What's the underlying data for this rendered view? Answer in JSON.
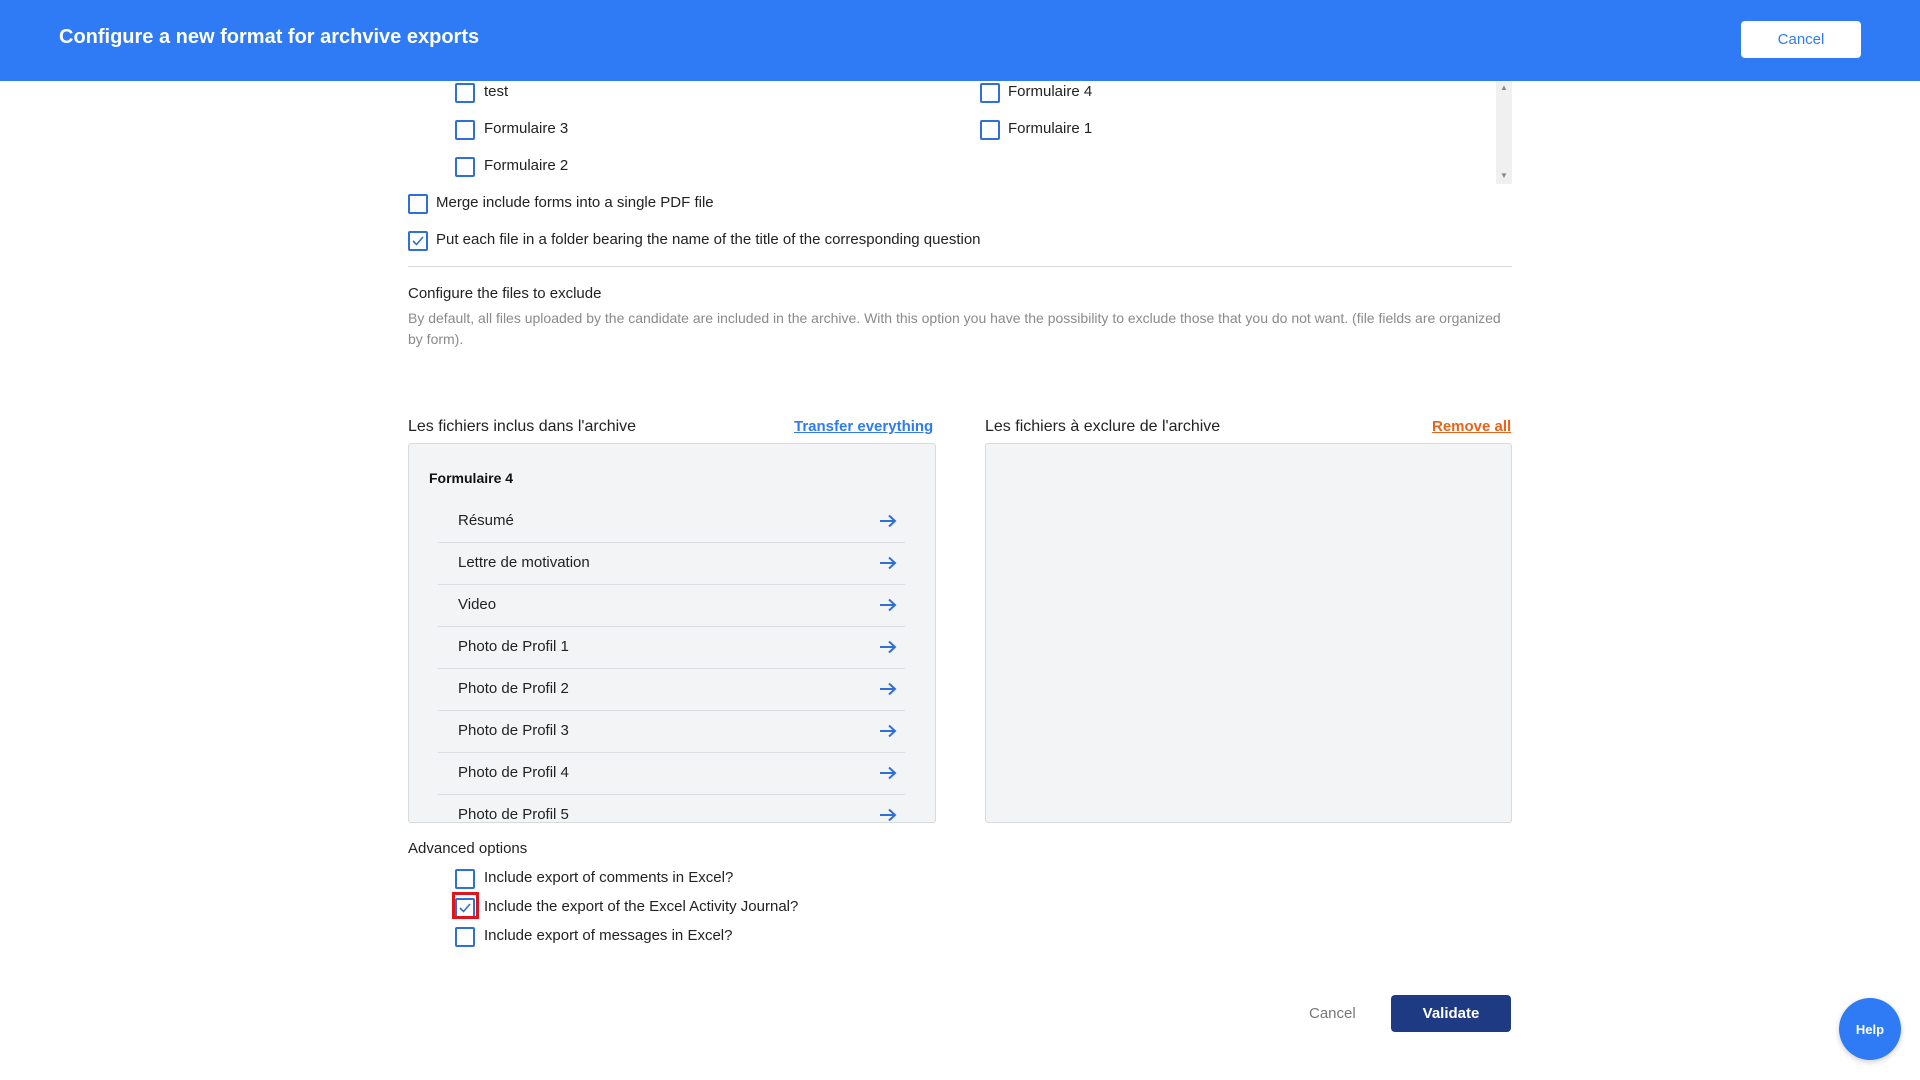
{
  "header": {
    "title": "Configure a new format for archvive exports",
    "cancel_label": "Cancel"
  },
  "forms": {
    "items": [
      {
        "label": "test",
        "checked": false
      },
      {
        "label": "Formulaire 3",
        "checked": false
      },
      {
        "label": "Formulaire 2",
        "checked": false
      },
      {
        "label": "Formulaire 4",
        "checked": false
      },
      {
        "label": "Formulaire 1",
        "checked": false
      }
    ]
  },
  "options": {
    "merge_label": "Merge include forms into a single PDF file",
    "merge_checked": false,
    "folder_label": "Put each file in a folder bearing the name of the title of the corresponding question",
    "folder_checked": true
  },
  "exclude": {
    "title": "Configure the files to exclude",
    "description": "By default, all files uploaded by the candidate are included in the archive. With this option you have the possibility to exclude those that you do not want. (file fields are organized by form)."
  },
  "included_panel": {
    "title": "Les fichiers inclus dans l'archive",
    "transfer_label": "Transfer everything",
    "group_title": "Formulaire 4",
    "files": [
      "Résumé",
      "Lettre de motivation",
      "Video",
      "Photo de Profil 1",
      "Photo de Profil 2",
      "Photo de Profil 3",
      "Photo de Profil 4",
      "Photo de Profil 5"
    ]
  },
  "excluded_panel": {
    "title": "Les fichiers à exclure de l'archive",
    "remove_label": "Remove all"
  },
  "advanced": {
    "title": "Advanced options",
    "items": [
      {
        "label": "Include export of comments in Excel?",
        "checked": false
      },
      {
        "label": "Include the export of the Excel Activity Journal?",
        "checked": true
      },
      {
        "label": "Include export of messages in Excel?",
        "checked": false
      }
    ]
  },
  "footer": {
    "cancel_label": "Cancel",
    "validate_label": "Validate"
  },
  "help": {
    "label": "Help"
  },
  "colors": {
    "header": "#2f7bf5",
    "validate": "#1d3a82",
    "remove_link": "#e8641b",
    "highlight": "#e0151b"
  }
}
